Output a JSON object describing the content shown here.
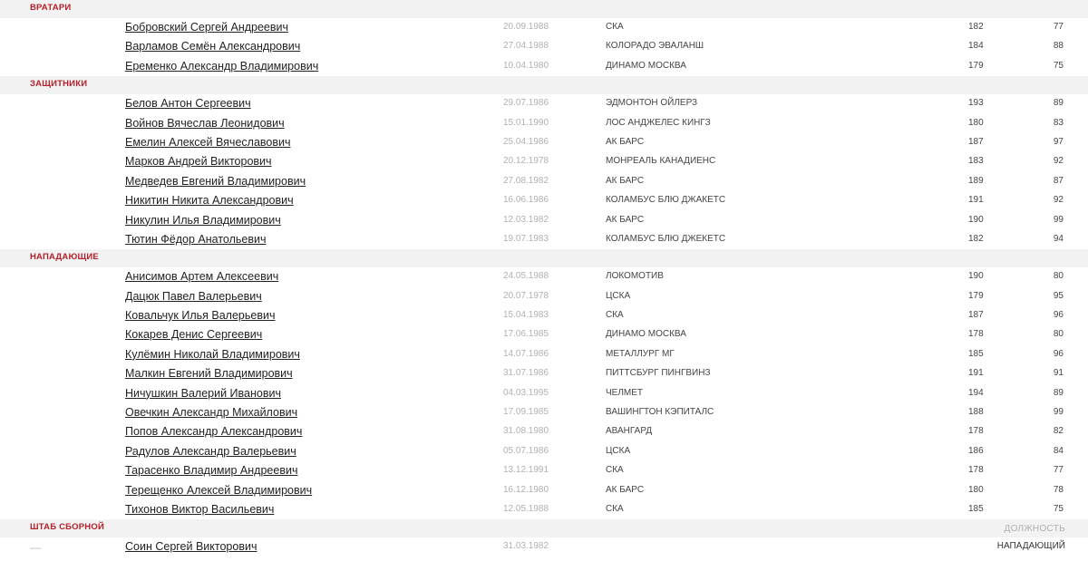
{
  "sections": [
    {
      "title": "ВРАТАРИ",
      "players": [
        {
          "name": "Бобровский Сергей Андреевич",
          "dob": "20.09.1988",
          "club": "СКА",
          "height": "182",
          "weight": "77"
        },
        {
          "name": "Варламов Семён Александрович",
          "dob": "27.04.1988",
          "club": "КОЛОРАДО ЭВАЛАНШ",
          "height": "184",
          "weight": "88"
        },
        {
          "name": "Еременко Александр Владимирович",
          "dob": "10.04.1980",
          "club": "ДИНАМО МОСКВА",
          "height": "179",
          "weight": "75"
        }
      ]
    },
    {
      "title": "ЗАЩИТНИКИ",
      "players": [
        {
          "name": "Белов Антон Сергеевич",
          "dob": "29.07.1986",
          "club": "ЭДМОНТОН ОЙЛЕРЗ",
          "height": "193",
          "weight": "89"
        },
        {
          "name": "Войнов Вячеслав Леонидович",
          "dob": "15.01.1990",
          "club": "ЛОС АНДЖЕЛЕС КИНГЗ",
          "height": "180",
          "weight": "83"
        },
        {
          "name": "Емелин Алексей Вячеславович",
          "dob": "25.04.1986",
          "club": "АК БАРС",
          "height": "187",
          "weight": "97"
        },
        {
          "name": "Марков Андрей Викторович",
          "dob": "20.12.1978",
          "club": "МОНРЕАЛЬ КАНАДИЕНС",
          "height": "183",
          "weight": "92"
        },
        {
          "name": "Медведев Евгений Владимирович",
          "dob": "27.08.1982",
          "club": "АК БАРС",
          "height": "189",
          "weight": "87"
        },
        {
          "name": "Никитин Никита Александрович",
          "dob": "16.06.1986",
          "club": "КОЛАМБУС БЛЮ ДЖАКЕТС",
          "height": "191",
          "weight": "92"
        },
        {
          "name": "Никулин Илья Владимирович",
          "dob": "12.03.1982",
          "club": "АК БАРС",
          "height": "190",
          "weight": "99"
        },
        {
          "name": "Тютин Фёдор Анатольевич",
          "dob": "19.07.1983",
          "club": "КОЛАМБУС БЛЮ ДЖЕКЕТС",
          "height": "182",
          "weight": "94"
        }
      ]
    },
    {
      "title": "НАПАДАЮЩИЕ",
      "players": [
        {
          "name": "Анисимов Артем Алексеевич",
          "dob": "24.05.1988",
          "club": "ЛОКОМОТИВ",
          "height": "190",
          "weight": "80"
        },
        {
          "name": "Дацюк Павел Валерьевич",
          "dob": "20.07.1978",
          "club": "ЦСКА",
          "height": "179",
          "weight": "95"
        },
        {
          "name": "Ковальчук Илья Валерьевич",
          "dob": "15.04.1983",
          "club": "СКА",
          "height": "187",
          "weight": "96"
        },
        {
          "name": "Кокарев Денис Сергеевич",
          "dob": "17.06.1985",
          "club": "ДИНАМО МОСКВА",
          "height": "178",
          "weight": "80"
        },
        {
          "name": "Кулёмин Николай Владимирович",
          "dob": "14.07.1986",
          "club": "МЕТАЛЛУРГ МГ",
          "height": "185",
          "weight": "96"
        },
        {
          "name": "Малкин Евгений Владимирович",
          "dob": "31.07.1986",
          "club": "ПИТТСБУРГ ПИНГВИНЗ",
          "height": "191",
          "weight": "91"
        },
        {
          "name": "Ничушкин Валерий Иванович",
          "dob": "04.03.1995",
          "club": "ЧЕЛМЕТ",
          "height": "194",
          "weight": "89"
        },
        {
          "name": "Овечкин Александр Михайлович",
          "dob": "17.09.1985",
          "club": "ВАШИНГТОН КЭПИТАЛС",
          "height": "188",
          "weight": "99"
        },
        {
          "name": "Попов Александр Александрович",
          "dob": "31.08.1980",
          "club": "АВАНГАРД",
          "height": "178",
          "weight": "82"
        },
        {
          "name": "Радулов Александр Валерьевич",
          "dob": "05.07.1986",
          "club": "ЦСКА",
          "height": "186",
          "weight": "84"
        },
        {
          "name": "Тарасенко Владимир Андреевич",
          "dob": "13.12.1991",
          "club": "СКА",
          "height": "178",
          "weight": "77"
        },
        {
          "name": "Терещенко Алексей Владимирович",
          "dob": "16.12.1980",
          "club": "АК БАРС",
          "height": "180",
          "weight": "78"
        },
        {
          "name": "Тихонов Виктор Васильевич",
          "dob": "12.05.1988",
          "club": "СКА",
          "height": "185",
          "weight": "75"
        }
      ]
    }
  ],
  "staff": {
    "title": "ШТАБ СБОРНОЙ",
    "column_label": "ДОЛЖНОСТЬ",
    "members": [
      {
        "dash": "—",
        "name": "Соин Сергей Викторович",
        "dob": "31.03.1982",
        "position": "НАПАДАЮЩИЙ"
      }
    ]
  },
  "colors": {
    "section_title": "#b5212a",
    "section_bg": "#f2f2f2"
  }
}
